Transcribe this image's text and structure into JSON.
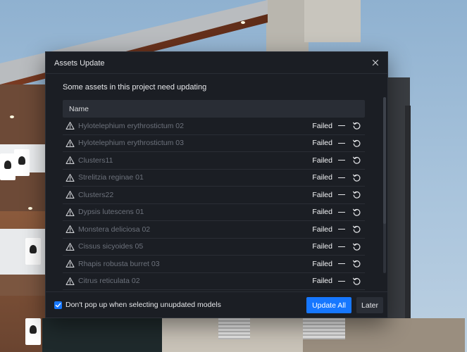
{
  "dialog": {
    "title": "Assets Update",
    "subtitle": "Some assets in this project need updating",
    "table": {
      "column_header": "Name",
      "rows": [
        {
          "name": "Hylotelephium erythrostictum 02",
          "status": "Failed"
        },
        {
          "name": "Hylotelephium erythrostictum 03",
          "status": "Failed"
        },
        {
          "name": "Clusters11",
          "status": "Failed"
        },
        {
          "name": "Strelitzia reginae 01",
          "status": "Failed"
        },
        {
          "name": "Clusters22",
          "status": "Failed"
        },
        {
          "name": "Dypsis lutescens 01",
          "status": "Failed"
        },
        {
          "name": "Monstera deliciosa 02",
          "status": "Failed"
        },
        {
          "name": "Cissus sicyoides 05",
          "status": "Failed"
        },
        {
          "name": "Rhapis robusta burret 03",
          "status": "Failed"
        },
        {
          "name": "Citrus reticulata 02",
          "status": "Failed"
        }
      ]
    },
    "footer": {
      "checkbox_label": "Don't pop up when selecting unupdated models",
      "checkbox_checked": true,
      "update_all_label": "Update All",
      "later_label": "Later"
    }
  },
  "icons": {
    "close": "close-icon",
    "row_status": "warning-triangle-icon",
    "row_action": "retry-icon",
    "checkbox": "checkmark-icon"
  },
  "colors": {
    "accent": "#1677ff",
    "dialog_bg": "#1b1e24",
    "header_row_bg": "#292d35",
    "asset_name_text": "#6d727c"
  }
}
